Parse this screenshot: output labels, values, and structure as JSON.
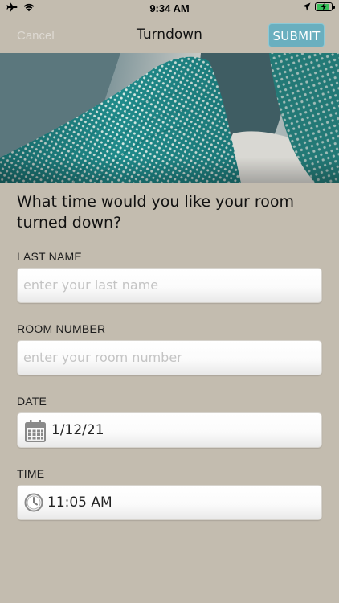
{
  "status_bar": {
    "time": "9:34 AM"
  },
  "nav": {
    "cancel_label": "Cancel",
    "title": "Turndown",
    "submit_label": "SUBMIT"
  },
  "form": {
    "question": "What time would you like your room turned down?",
    "last_name": {
      "label": "LAST NAME",
      "placeholder": "enter your last name",
      "value": ""
    },
    "room_number": {
      "label": "ROOM NUMBER",
      "placeholder": "enter your room number",
      "value": ""
    },
    "date": {
      "label": "DATE",
      "value": "1/12/21",
      "icon": "calendar-icon"
    },
    "time": {
      "label": "TIME",
      "value": "11:05 AM",
      "icon": "clock-icon"
    }
  },
  "colors": {
    "background": "#c3bcaf",
    "accent": "#6aafbf",
    "battery": "#38c15a"
  }
}
